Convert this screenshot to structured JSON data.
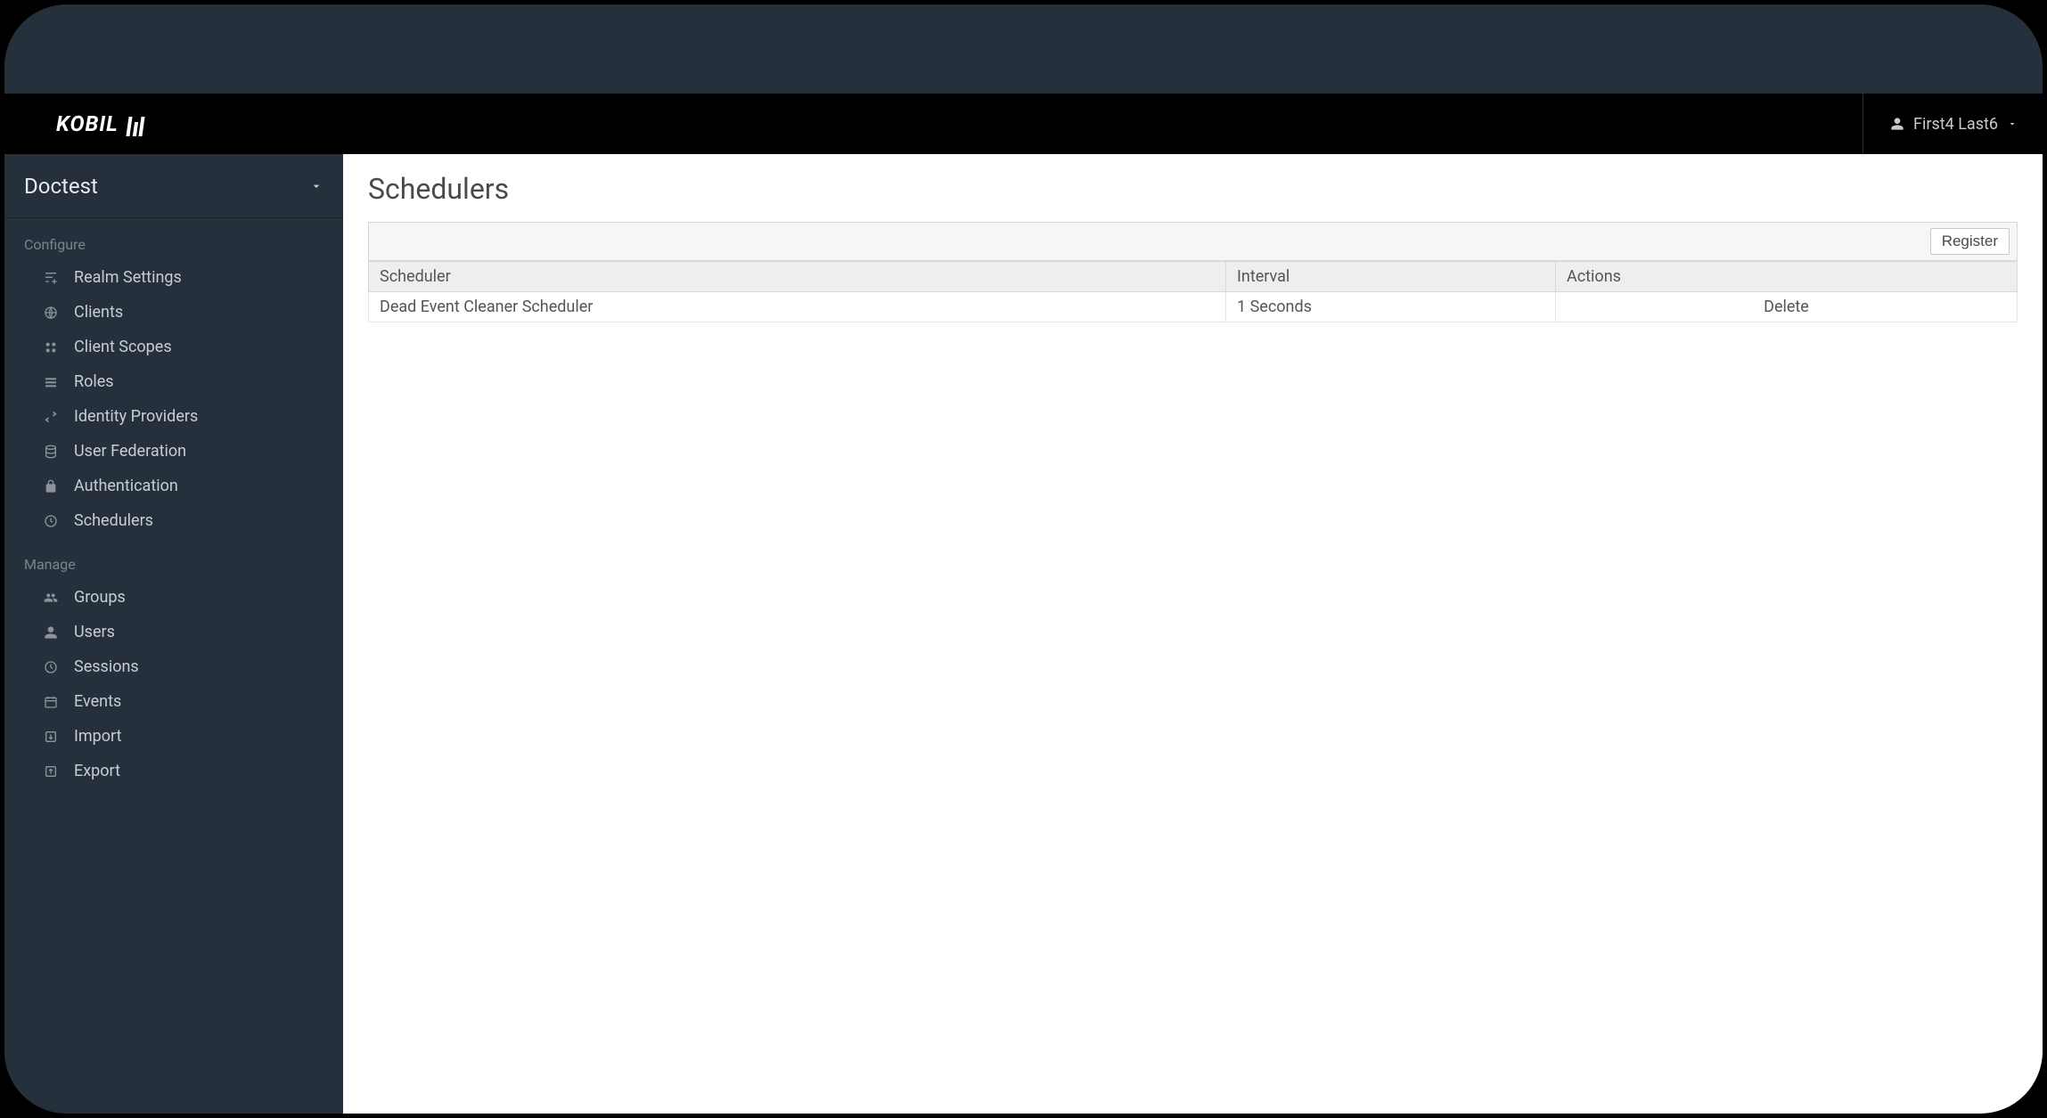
{
  "brand": {
    "name": "KOBIL"
  },
  "header": {
    "user_name": "First4 Last6"
  },
  "realm": {
    "name": "Doctest"
  },
  "sidebar": {
    "section_configure": "Configure",
    "section_manage": "Manage",
    "configure": [
      {
        "label": "Realm Settings"
      },
      {
        "label": "Clients"
      },
      {
        "label": "Client Scopes"
      },
      {
        "label": "Roles"
      },
      {
        "label": "Identity Providers"
      },
      {
        "label": "User Federation"
      },
      {
        "label": "Authentication"
      },
      {
        "label": "Schedulers"
      }
    ],
    "manage": [
      {
        "label": "Groups"
      },
      {
        "label": "Users"
      },
      {
        "label": "Sessions"
      },
      {
        "label": "Events"
      },
      {
        "label": "Import"
      },
      {
        "label": "Export"
      }
    ]
  },
  "page": {
    "title": "Schedulers",
    "register_button": "Register",
    "columns": {
      "scheduler": "Scheduler",
      "interval": "Interval",
      "actions": "Actions"
    },
    "rows": [
      {
        "scheduler": "Dead Event Cleaner Scheduler",
        "interval": "1 Seconds",
        "action": "Delete"
      }
    ]
  }
}
